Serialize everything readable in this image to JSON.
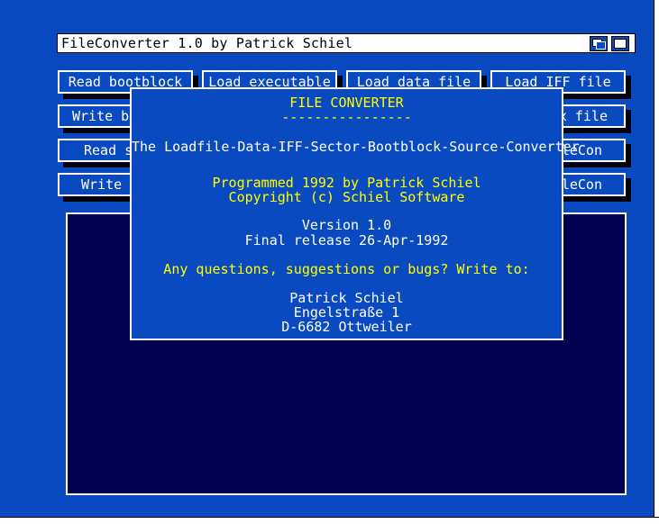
{
  "window": {
    "title": "FileConverter 1.0 by Patrick Schiel",
    "depth_gadget_icon": "depth-arrange-icon",
    "zoom_gadget_icon": "zoom-icon"
  },
  "buttons": [
    [
      "Read bootblock",
      "Load executable",
      "Load data file",
      "Load IFF file"
    ],
    [
      "Write bo",
      "",
      "",
      ".x file"
    ],
    [
      "Read s",
      "",
      "",
      "ileCon"
    ],
    [
      "Write s",
      "",
      "",
      "ileCon"
    ]
  ],
  "dialog": {
    "heading": "FILE CONVERTER",
    "underline": "----------------",
    "subtitle": "The Loadfile-Data-IFF-Sector-Bootblock-Source-Converter",
    "programmed": "Programmed 1992 by Patrick Schiel",
    "copyright": "Copyright (c) Schiel Software",
    "version": "Version 1.0",
    "release": "Final release 26-Apr-1992",
    "questions": "Any questions, suggestions or bugs?  Write to:",
    "name": "Patrick Schiel",
    "street": "Engelstraße 1",
    "city": "D-6682 Ottweiler"
  },
  "colors": {
    "background": "#0a4ac0",
    "output": "#000050",
    "text": "#ffffff",
    "highlight": "#ffff00"
  }
}
